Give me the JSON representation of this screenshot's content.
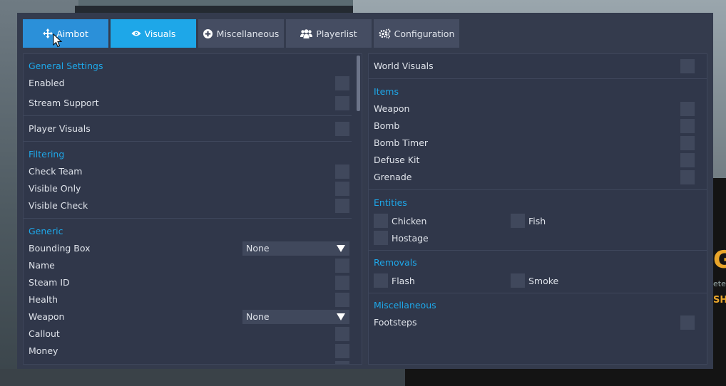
{
  "tabs": [
    {
      "label": "Aimbot",
      "icon": "move-arrows-icon"
    },
    {
      "label": "Visuals",
      "icon": "eye-icon"
    },
    {
      "label": "Miscellaneous",
      "icon": "plus-circle-icon"
    },
    {
      "label": "Playerlist",
      "icon": "users-icon"
    },
    {
      "label": "Configuration",
      "icon": "gears-icon"
    }
  ],
  "accent_color": "#1ea7e8",
  "left": {
    "general_title": "General Settings",
    "enabled": "Enabled",
    "stream_support": "Stream Support",
    "player_visuals": "Player Visuals",
    "filtering_title": "Filtering",
    "check_team": "Check Team",
    "visible_only": "Visible Only",
    "visible_check": "Visible Check",
    "generic_title": "Generic",
    "bounding_box": "Bounding Box",
    "bounding_box_value": "None",
    "name": "Name",
    "steam_id": "Steam ID",
    "health": "Health",
    "weapon": "Weapon",
    "weapon_value": "None",
    "callout": "Callout",
    "money": "Money"
  },
  "right": {
    "world_visuals": "World Visuals",
    "items_title": "Items",
    "weapon": "Weapon",
    "bomb": "Bomb",
    "bomb_timer": "Bomb Timer",
    "defuse_kit": "Defuse Kit",
    "grenade": "Grenade",
    "entities_title": "Entities",
    "chicken": "Chicken",
    "fish": "Fish",
    "hostage": "Hostage",
    "removals_title": "Removals",
    "flash": "Flash",
    "smoke": "Smoke",
    "misc_title": "Miscellaneous",
    "footsteps": "Footsteps"
  },
  "background_text": {
    "big": "G",
    "small": "ete",
    "orange": "SH"
  }
}
